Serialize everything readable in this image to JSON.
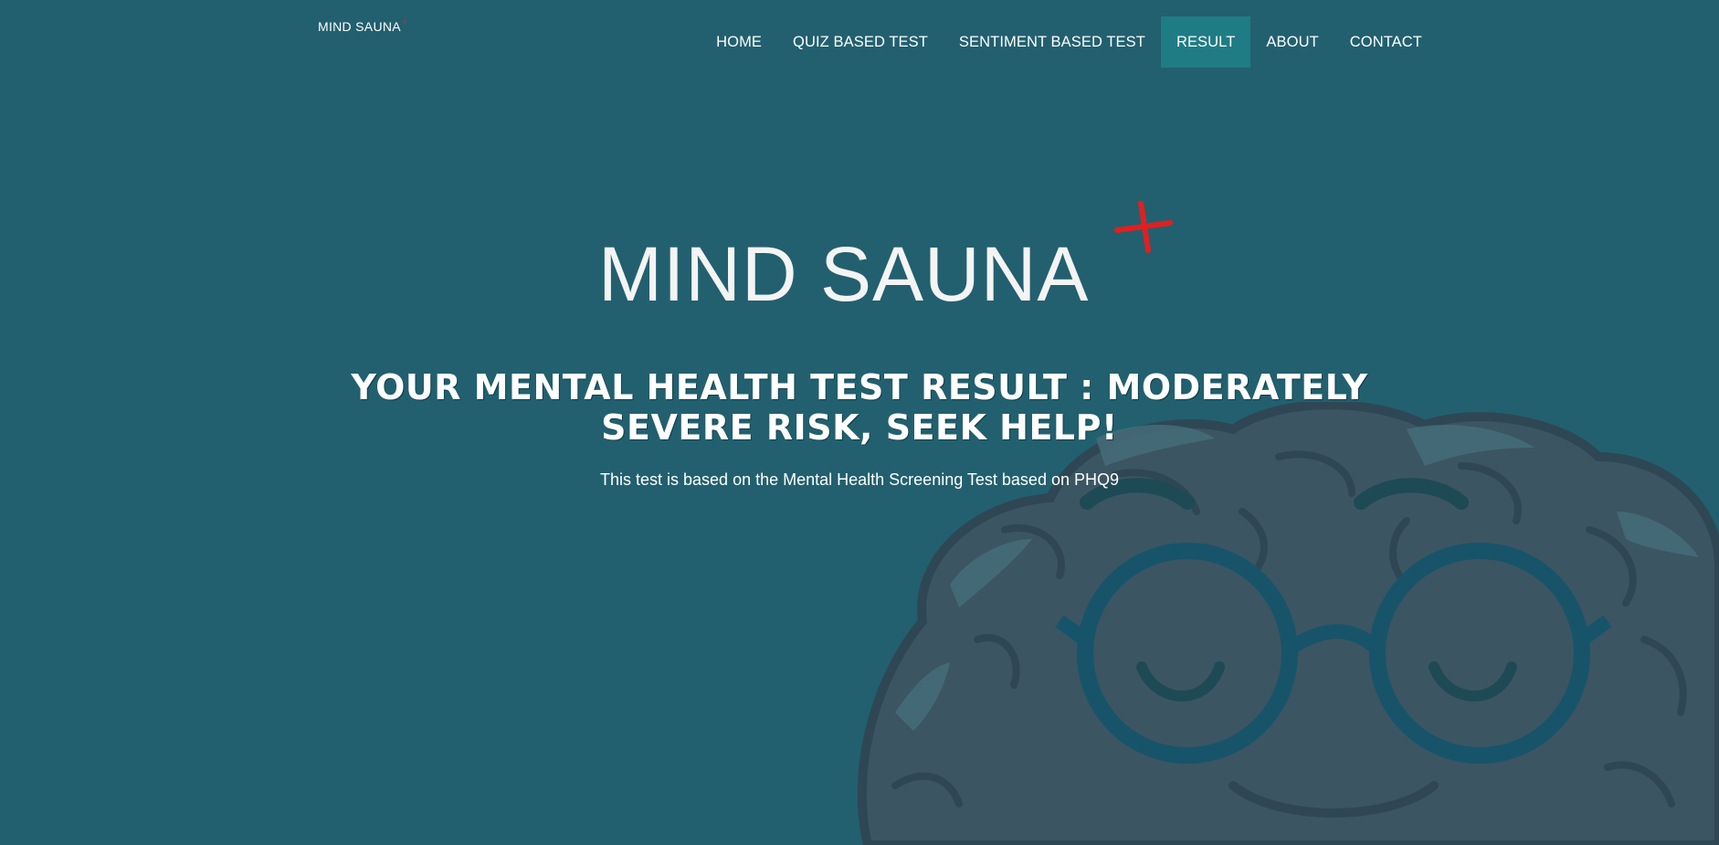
{
  "colors": {
    "background": "#22606f",
    "nav_active": "#1f7c84",
    "accent_plus": "#e02020",
    "text": "#ffffff"
  },
  "brand": {
    "name": "MIND SAUNA",
    "plus_icon": "red-plus-icon"
  },
  "nav": {
    "items": [
      {
        "label": "HOME",
        "active": false
      },
      {
        "label": "QUIZ BASED TEST",
        "active": false
      },
      {
        "label": "SENTIMENT BASED TEST",
        "active": false
      },
      {
        "label": "RESULT",
        "active": true
      },
      {
        "label": "ABOUT",
        "active": false
      },
      {
        "label": "CONTACT",
        "active": false
      }
    ]
  },
  "hero": {
    "logo_text": "MIND SAUNA",
    "headline": "YOUR MENTAL HEALTH TEST RESULT : MODERATELY SEVERE RISK, SEEK HELP!",
    "subtext": "This test is based on the Mental Health Screening Test based on PHQ9"
  },
  "illustration": {
    "icon": "smiling-brain-with-glasses-illustration"
  }
}
